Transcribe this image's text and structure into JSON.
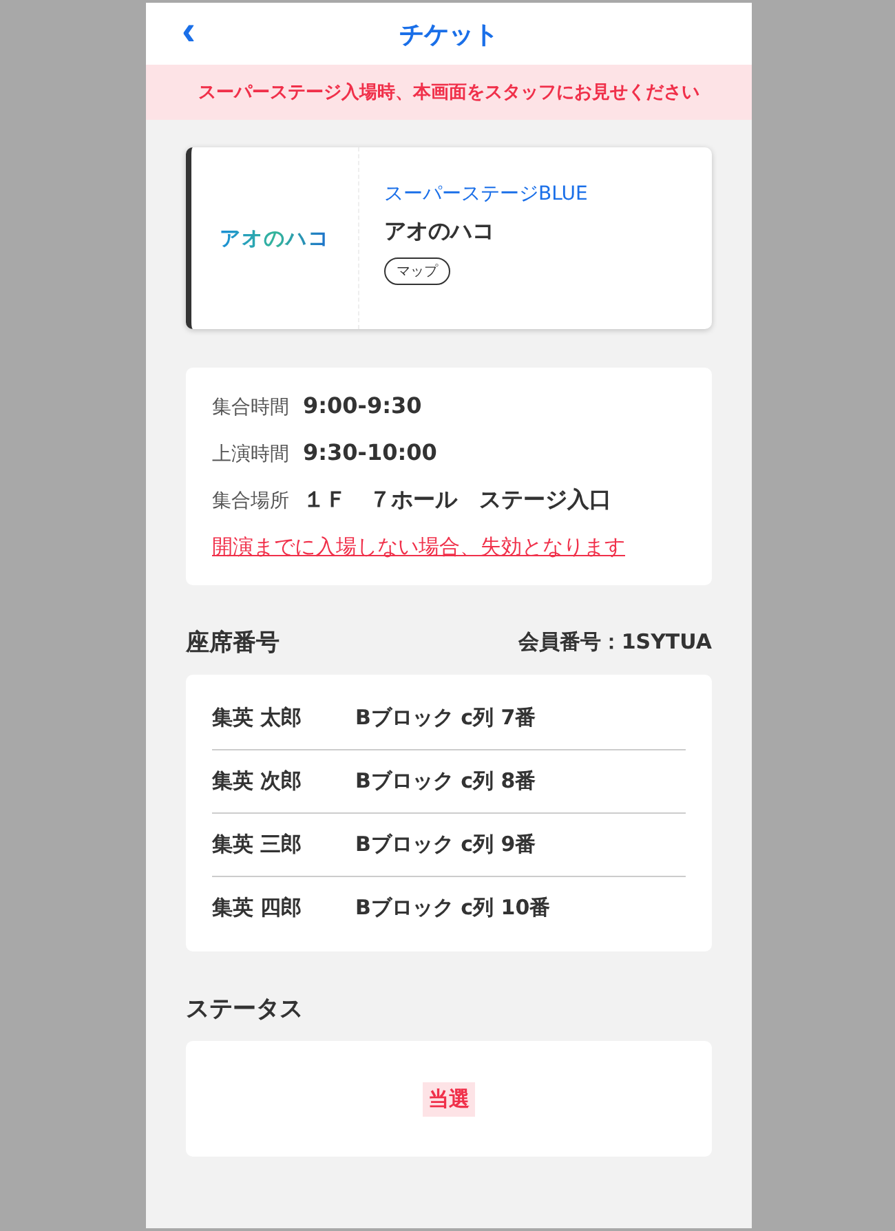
{
  "header": {
    "back": "‹",
    "title": "チケット"
  },
  "notice": "スーパーステージ入場時、本画面をスタッフにお見せください",
  "event": {
    "logo": "アオのハコ",
    "stage": "スーパーステージBLUE",
    "title": "アオのハコ",
    "map_button": "マップ"
  },
  "details": [
    {
      "label": "集合時間",
      "value": "9:00-9:30"
    },
    {
      "label": "上演時間",
      "value": "9:30-10:00"
    },
    {
      "label": "集合場所",
      "value": "１Ｆ　７ホール　ステージ入口"
    }
  ],
  "warning": "開演までに入場しない場合、失効となります",
  "seats": {
    "heading": "座席番号",
    "member": "会員番号：1SYTUA",
    "rows": [
      {
        "name": "集英 太郎",
        "seat": "Bブロック c列 7番"
      },
      {
        "name": "集英 次郎",
        "seat": "Bブロック c列 8番"
      },
      {
        "name": "集英 三郎",
        "seat": "Bブロック c列 9番"
      },
      {
        "name": "集英 四郎",
        "seat": "Bブロック c列 10番"
      }
    ]
  },
  "status": {
    "heading": "ステータス",
    "value": "当選"
  }
}
